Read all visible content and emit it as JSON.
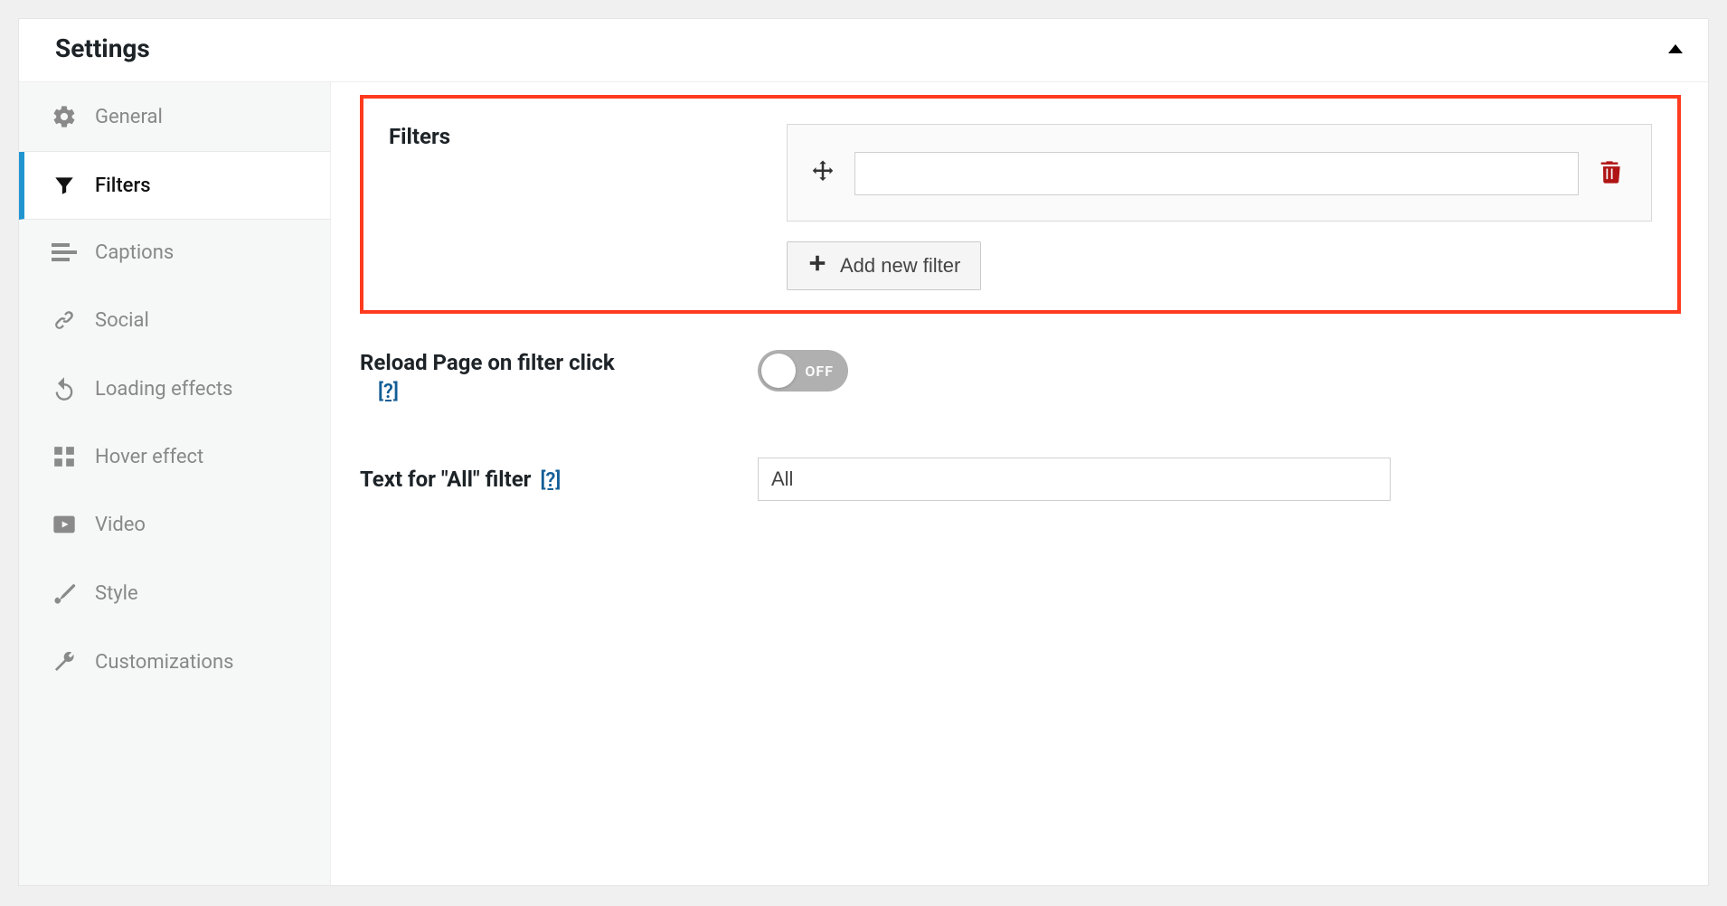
{
  "panel": {
    "title": "Settings"
  },
  "sidebar": {
    "items": [
      {
        "label": "General"
      },
      {
        "label": "Filters"
      },
      {
        "label": "Captions"
      },
      {
        "label": "Social"
      },
      {
        "label": "Loading effects"
      },
      {
        "label": "Hover effect"
      },
      {
        "label": "Video"
      },
      {
        "label": "Style"
      },
      {
        "label": "Customizations"
      }
    ]
  },
  "filters": {
    "section_label": "Filters",
    "filter_items": [
      {
        "value": ""
      }
    ],
    "add_button_label": "Add new filter"
  },
  "reload": {
    "label": "Reload Page on filter click",
    "help": "[?]",
    "state_label": "OFF"
  },
  "all_filter": {
    "label": "Text for \"All\" filter",
    "help": "[?]",
    "value": "All"
  }
}
